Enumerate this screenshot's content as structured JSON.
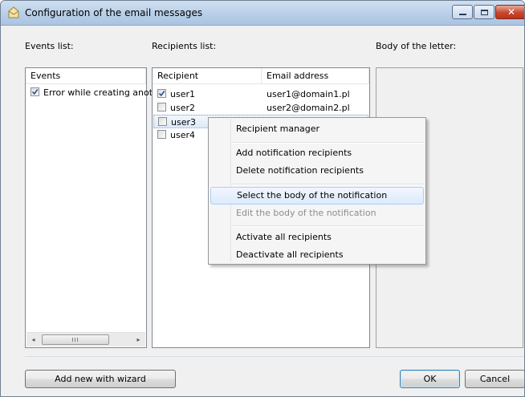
{
  "window": {
    "title": "Configuration of the email messages",
    "icon": "envelope-icon",
    "buttons": {
      "minimize": "minimize-icon",
      "maximize": "maximize-icon",
      "close": "close-icon"
    }
  },
  "labels": {
    "events_list": "Events list:",
    "recipients_list": "Recipients list:",
    "body": "Body of the letter:"
  },
  "events": {
    "header": "Events",
    "items": [
      {
        "label": "Error while creating anoth",
        "checked": true
      }
    ]
  },
  "recipients": {
    "headers": {
      "recipient": "Recipient",
      "email": "Email address"
    },
    "rows": [
      {
        "name": "user1",
        "email": "user1@domain1.pl",
        "checked": true
      },
      {
        "name": "user2",
        "email": "user2@domain2.pl",
        "checked": false
      },
      {
        "name": "user3",
        "email": "",
        "checked": false
      },
      {
        "name": "user4",
        "email": "",
        "checked": false
      }
    ]
  },
  "context_menu": {
    "items": [
      {
        "label": "Recipient manager"
      },
      {
        "label": "Add notification recipients"
      },
      {
        "label": "Delete notification recipients"
      },
      {
        "label": "Select the body of the notification"
      },
      {
        "label": "Edit the body of the notification"
      },
      {
        "label": "Activate all recipients"
      },
      {
        "label": "Deactivate all recipients"
      }
    ]
  },
  "buttons": {
    "wizard": "Add new with wizard",
    "ok": "OK",
    "cancel": "Cancel"
  },
  "scrollbar": {
    "left_arrow": "◂",
    "right_arrow": "▸",
    "grip": "III"
  },
  "colors": {
    "titlebar": "#b9cfe8",
    "selection": "#dce9f8",
    "close": "#c9472d"
  }
}
